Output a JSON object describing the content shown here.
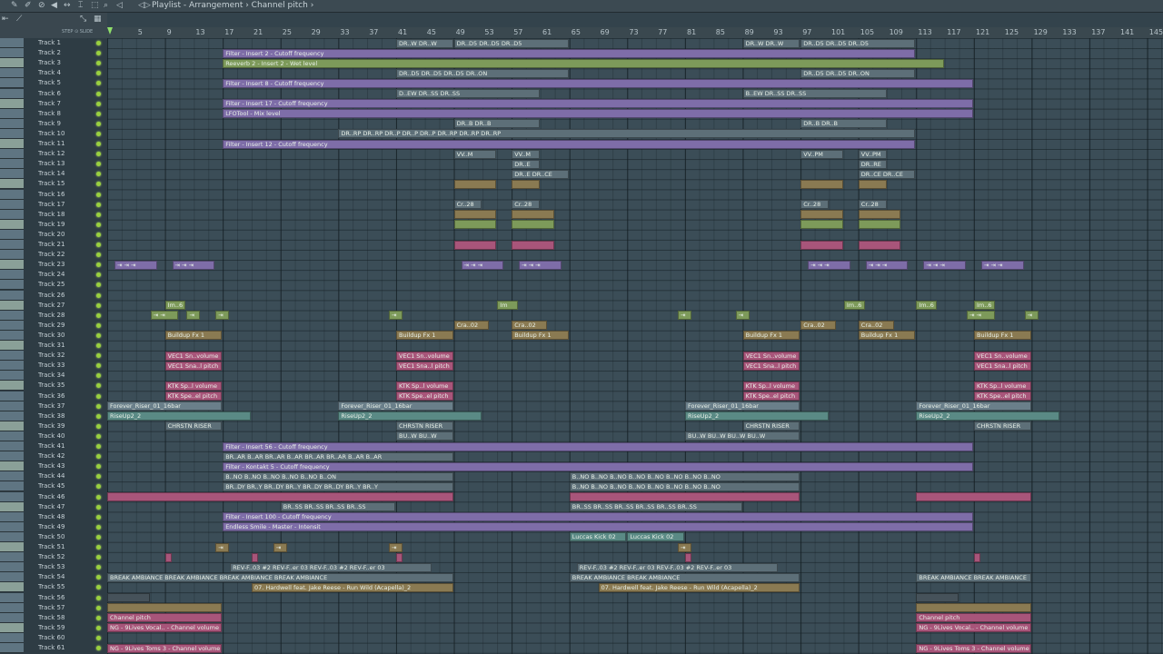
{
  "window": {
    "breadcrumb": "Playlist - Arrangement › Channel pitch ›"
  },
  "snap": {
    "label": "STEP ⊙ SLIDE"
  },
  "ruler": {
    "ticks": [
      "5",
      "9",
      "13",
      "17",
      "21",
      "25",
      "29",
      "33",
      "37",
      "41",
      "45",
      "49",
      "53",
      "57",
      "61",
      "65",
      "69",
      "73",
      "77",
      "81",
      "85",
      "89",
      "93",
      "97",
      "101",
      "105",
      "109",
      "113",
      "117",
      "121",
      "125",
      "129",
      "133",
      "137",
      "141",
      "145"
    ]
  },
  "tracks": [
    "Track 1",
    "Track 2",
    "Track 3",
    "Track 4",
    "Track 5",
    "Track 6",
    "Track 7",
    "Track 8",
    "Track 9",
    "Track 10",
    "Track 11",
    "Track 12",
    "Track 13",
    "Track 14",
    "Track 15",
    "Track 16",
    "Track 17",
    "Track 18",
    "Track 19",
    "Track 20",
    "Track 21",
    "Track 22",
    "Track 23",
    "Track 24",
    "Track 25",
    "Track 26",
    "Track 27",
    "Track 28",
    "Track 29",
    "Track 30",
    "Track 31",
    "Track 32",
    "Track 33",
    "Track 34",
    "Track 35",
    "Track 36",
    "Track 37",
    "Track 38",
    "Track 39",
    "Track 40",
    "Track 41",
    "Track 42",
    "Track 43",
    "Track 44",
    "Track 45",
    "Track 46",
    "Track 47",
    "Track 48",
    "Track 49",
    "Track 50",
    "Track 51",
    "Track 52",
    "Track 53",
    "Track 54",
    "Track 55",
    "Track 56",
    "Track 57",
    "Track 58",
    "Track 59",
    "Track 60",
    "Track 61"
  ],
  "clips": [
    {
      "t": 1,
      "s": 41,
      "e": 49,
      "c": "grey",
      "l": "DR..W  DR..W"
    },
    {
      "t": 1,
      "s": 49,
      "e": 65,
      "c": "grey",
      "l": "DR..D5  DR..D5  DR..D5"
    },
    {
      "t": 1,
      "s": 89,
      "e": 97,
      "c": "grey",
      "l": "DR..W  DR..W"
    },
    {
      "t": 1,
      "s": 97,
      "e": 113,
      "c": "grey",
      "l": "DR..D5  DR..D5  DR..D5"
    },
    {
      "t": 2,
      "s": 17,
      "e": 113,
      "c": "purple",
      "l": "Filter - Insert 2 - Cutoff frequency"
    },
    {
      "t": 3,
      "s": 17,
      "e": 117,
      "c": "green",
      "l": "Reeverb 2 - Insert 2 - Wet level"
    },
    {
      "t": 4,
      "s": 41,
      "e": 65,
      "c": "grey",
      "l": "DR..D5  DR..D5  DR..D5  DR..ON"
    },
    {
      "t": 4,
      "s": 97,
      "e": 113,
      "c": "grey",
      "l": "DR..D5  DR..D5  DR..ON"
    },
    {
      "t": 5,
      "s": 17,
      "e": 121,
      "c": "purple",
      "l": "Filter - Insert 8 - Cutoff frequency"
    },
    {
      "t": 6,
      "s": 41,
      "e": 61,
      "c": "grey",
      "l": "D..EW  DR..SS  DR..SS"
    },
    {
      "t": 6,
      "s": 89,
      "e": 109,
      "c": "grey",
      "l": "B..EW  DR..SS  DR..SS"
    },
    {
      "t": 7,
      "s": 17,
      "e": 121,
      "c": "purple",
      "l": "Filter - Insert 17 - Cutoff frequency"
    },
    {
      "t": 8,
      "s": 17,
      "e": 121,
      "c": "purple",
      "l": "LFOTool - Mix level"
    },
    {
      "t": 9,
      "s": 49,
      "e": 61,
      "c": "grey",
      "l": "DR..B  DR..B"
    },
    {
      "t": 9,
      "s": 97,
      "e": 109,
      "c": "grey",
      "l": "DR..B  DR..B"
    },
    {
      "t": 10,
      "s": 33,
      "e": 113,
      "c": "grey",
      "l": "DR..RP  DR..RP  DR..P  DR..P  DR..P  DR..RP  DR..RP  DR..RP"
    },
    {
      "t": 11,
      "s": 17,
      "e": 113,
      "c": "purple",
      "l": "Filter - Insert 12 - Cutoff frequency"
    },
    {
      "t": 12,
      "s": 49,
      "e": 55,
      "c": "grey",
      "l": "VV..M"
    },
    {
      "t": 12,
      "s": 57,
      "e": 61,
      "c": "grey",
      "l": "VV..M"
    },
    {
      "t": 12,
      "s": 97,
      "e": 103,
      "c": "grey",
      "l": "VV..PM"
    },
    {
      "t": 12,
      "s": 105,
      "e": 109,
      "c": "grey",
      "l": "VV..PM"
    },
    {
      "t": 13,
      "s": 57,
      "e": 61,
      "c": "grey",
      "l": "DR..E"
    },
    {
      "t": 13,
      "s": 105,
      "e": 109,
      "c": "grey",
      "l": "DR..RE"
    },
    {
      "t": 14,
      "s": 57,
      "e": 65,
      "c": "grey",
      "l": "DR..E  DR..CE"
    },
    {
      "t": 14,
      "s": 105,
      "e": 113,
      "c": "grey",
      "l": "DR..CE  DR..CE"
    },
    {
      "t": 15,
      "s": 49,
      "e": 55,
      "c": "gold",
      "l": ""
    },
    {
      "t": 15,
      "s": 57,
      "e": 61,
      "c": "gold",
      "l": ""
    },
    {
      "t": 15,
      "s": 97,
      "e": 103,
      "c": "gold",
      "l": ""
    },
    {
      "t": 15,
      "s": 105,
      "e": 109,
      "c": "gold",
      "l": ""
    },
    {
      "t": 17,
      "s": 49,
      "e": 53,
      "c": "grey",
      "l": "Cr..28"
    },
    {
      "t": 17,
      "s": 57,
      "e": 61,
      "c": "grey",
      "l": "Cr..28"
    },
    {
      "t": 17,
      "s": 97,
      "e": 101,
      "c": "grey",
      "l": "Cr..28"
    },
    {
      "t": 17,
      "s": 105,
      "e": 109,
      "c": "grey",
      "l": "Cr..28"
    },
    {
      "t": 18,
      "s": 49,
      "e": 55,
      "c": "gold",
      "l": ""
    },
    {
      "t": 18,
      "s": 57,
      "e": 63,
      "c": "gold",
      "l": ""
    },
    {
      "t": 18,
      "s": 97,
      "e": 103,
      "c": "gold",
      "l": ""
    },
    {
      "t": 18,
      "s": 105,
      "e": 111,
      "c": "gold",
      "l": ""
    },
    {
      "t": 19,
      "s": 49,
      "e": 55,
      "c": "green",
      "l": ""
    },
    {
      "t": 19,
      "s": 57,
      "e": 63,
      "c": "green",
      "l": ""
    },
    {
      "t": 19,
      "s": 97,
      "e": 103,
      "c": "green",
      "l": ""
    },
    {
      "t": 19,
      "s": 105,
      "e": 111,
      "c": "green",
      "l": ""
    },
    {
      "t": 21,
      "s": 49,
      "e": 55,
      "c": "pink",
      "l": ""
    },
    {
      "t": 21,
      "s": 57,
      "e": 63,
      "c": "pink",
      "l": ""
    },
    {
      "t": 21,
      "s": 97,
      "e": 103,
      "c": "pink",
      "l": ""
    },
    {
      "t": 21,
      "s": 105,
      "e": 111,
      "c": "pink",
      "l": ""
    },
    {
      "t": 23,
      "s": 2,
      "e": 8,
      "c": "purple",
      "l": "⇥ ⇥ ⇥"
    },
    {
      "t": 23,
      "s": 10,
      "e": 16,
      "c": "purple",
      "l": "⇥ ⇥ ⇥"
    },
    {
      "t": 23,
      "s": 50,
      "e": 56,
      "c": "purple",
      "l": "⇥ ⇥ ⇥"
    },
    {
      "t": 23,
      "s": 58,
      "e": 64,
      "c": "purple",
      "l": "⇥ ⇥ ⇥"
    },
    {
      "t": 23,
      "s": 98,
      "e": 104,
      "c": "purple",
      "l": "⇥ ⇥ ⇥"
    },
    {
      "t": 23,
      "s": 106,
      "e": 112,
      "c": "purple",
      "l": "⇥ ⇥ ⇥"
    },
    {
      "t": 23,
      "s": 114,
      "e": 120,
      "c": "purple",
      "l": "⇥ ⇥ ⇥"
    },
    {
      "t": 23,
      "s": 122,
      "e": 128,
      "c": "purple",
      "l": "⇥ ⇥ ⇥"
    },
    {
      "t": 27,
      "s": 9,
      "e": 12,
      "c": "green",
      "l": "Im..6"
    },
    {
      "t": 27,
      "s": 55,
      "e": 58,
      "c": "green",
      "l": "Im"
    },
    {
      "t": 27,
      "s": 103,
      "e": 106,
      "c": "green",
      "l": "Im..6"
    },
    {
      "t": 27,
      "s": 113,
      "e": 116,
      "c": "green",
      "l": "Im..6"
    },
    {
      "t": 27,
      "s": 121,
      "e": 124,
      "c": "green",
      "l": "Im..6"
    },
    {
      "t": 28,
      "s": 7,
      "e": 11,
      "c": "green",
      "l": "⇥ ⇥"
    },
    {
      "t": 28,
      "s": 12,
      "e": 14,
      "c": "green",
      "l": "⇥"
    },
    {
      "t": 28,
      "s": 16,
      "e": 18,
      "c": "green",
      "l": "⇥"
    },
    {
      "t": 28,
      "s": 40,
      "e": 42,
      "c": "green",
      "l": "⇥"
    },
    {
      "t": 28,
      "s": 80,
      "e": 82,
      "c": "green",
      "l": "⇥"
    },
    {
      "t": 28,
      "s": 88,
      "e": 90,
      "c": "green",
      "l": "⇥"
    },
    {
      "t": 28,
      "s": 120,
      "e": 124,
      "c": "green",
      "l": "⇥ ⇥"
    },
    {
      "t": 28,
      "s": 128,
      "e": 130,
      "c": "green",
      "l": "⇥"
    },
    {
      "t": 29,
      "s": 49,
      "e": 54,
      "c": "gold",
      "l": "Cra..02"
    },
    {
      "t": 29,
      "s": 57,
      "e": 62,
      "c": "gold",
      "l": "Cra..02"
    },
    {
      "t": 29,
      "s": 97,
      "e": 102,
      "c": "gold",
      "l": "Cra..02"
    },
    {
      "t": 29,
      "s": 105,
      "e": 110,
      "c": "gold",
      "l": "Cra..02"
    },
    {
      "t": 30,
      "s": 9,
      "e": 17,
      "c": "gold",
      "l": "Buildup Fx 1"
    },
    {
      "t": 30,
      "s": 41,
      "e": 49,
      "c": "gold",
      "l": "Buildup Fx 1"
    },
    {
      "t": 30,
      "s": 57,
      "e": 65,
      "c": "gold",
      "l": "Buildup Fx 1"
    },
    {
      "t": 30,
      "s": 89,
      "e": 97,
      "c": "gold",
      "l": "Buildup Fx 1"
    },
    {
      "t": 30,
      "s": 105,
      "e": 113,
      "c": "gold",
      "l": "Buildup Fx 1"
    },
    {
      "t": 30,
      "s": 121,
      "e": 129,
      "c": "gold",
      "l": "Buildup Fx 1"
    },
    {
      "t": 32,
      "s": 9,
      "e": 17,
      "c": "pink",
      "l": "VEC1 Sn..volume"
    },
    {
      "t": 32,
      "s": 41,
      "e": 49,
      "c": "pink",
      "l": "VEC1 Sn..volume"
    },
    {
      "t": 32,
      "s": 89,
      "e": 97,
      "c": "pink",
      "l": "VEC1 Sn..volume"
    },
    {
      "t": 32,
      "s": 121,
      "e": 129,
      "c": "pink",
      "l": "VEC1 Sn..volume"
    },
    {
      "t": 33,
      "s": 9,
      "e": 17,
      "c": "pink",
      "l": "VEC1 Sna..l pitch"
    },
    {
      "t": 33,
      "s": 41,
      "e": 49,
      "c": "pink",
      "l": "VEC1 Sna..l pitch"
    },
    {
      "t": 33,
      "s": 89,
      "e": 97,
      "c": "pink",
      "l": "VEC1 Sna..l pitch"
    },
    {
      "t": 33,
      "s": 121,
      "e": 129,
      "c": "pink",
      "l": "VEC1 Sna..l pitch"
    },
    {
      "t": 35,
      "s": 9,
      "e": 17,
      "c": "pink",
      "l": "KTK Sp..l volume"
    },
    {
      "t": 35,
      "s": 41,
      "e": 49,
      "c": "pink",
      "l": "KTK Sp..l volume"
    },
    {
      "t": 35,
      "s": 89,
      "e": 97,
      "c": "pink",
      "l": "KTK Sp..l volume"
    },
    {
      "t": 35,
      "s": 121,
      "e": 129,
      "c": "pink",
      "l": "KTK Sp..l volume"
    },
    {
      "t": 36,
      "s": 9,
      "e": 17,
      "c": "pink",
      "l": "KTK Spe..el pitch"
    },
    {
      "t": 36,
      "s": 41,
      "e": 49,
      "c": "pink",
      "l": "KTK Spe..el pitch"
    },
    {
      "t": 36,
      "s": 89,
      "e": 97,
      "c": "pink",
      "l": "KTK Spe..el pitch"
    },
    {
      "t": 36,
      "s": 121,
      "e": 129,
      "c": "pink",
      "l": "KTK Spe..el pitch"
    },
    {
      "t": 37,
      "s": 1,
      "e": 17,
      "c": "steel",
      "l": "Forever_Riser_01_16bar"
    },
    {
      "t": 37,
      "s": 33,
      "e": 49,
      "c": "steel",
      "l": "Forever_Riser_01_16bar"
    },
    {
      "t": 37,
      "s": 81,
      "e": 97,
      "c": "steel",
      "l": "Forever_Riser_01_16bar"
    },
    {
      "t": 37,
      "s": 113,
      "e": 129,
      "c": "steel",
      "l": "Forever_Riser_01_16bar"
    },
    {
      "t": 38,
      "s": 1,
      "e": 21,
      "c": "teal",
      "l": "RiseUp2_2"
    },
    {
      "t": 38,
      "s": 33,
      "e": 53,
      "c": "teal",
      "l": "RiseUp2_2"
    },
    {
      "t": 38,
      "s": 81,
      "e": 101,
      "c": "teal",
      "l": "RiseUp2_2"
    },
    {
      "t": 38,
      "s": 113,
      "e": 133,
      "c": "teal",
      "l": "RiseUp2_2"
    },
    {
      "t": 39,
      "s": 9,
      "e": 17,
      "c": "grey",
      "l": "CHRSTN RISER"
    },
    {
      "t": 39,
      "s": 41,
      "e": 49,
      "c": "grey",
      "l": "CHRSTN RISER"
    },
    {
      "t": 39,
      "s": 89,
      "e": 97,
      "c": "grey",
      "l": "CHRSTN RISER"
    },
    {
      "t": 39,
      "s": 121,
      "e": 129,
      "c": "grey",
      "l": "CHRSTN RISER"
    },
    {
      "t": 40,
      "s": 41,
      "e": 49,
      "c": "grey",
      "l": "BU..W  BU..W"
    },
    {
      "t": 40,
      "s": 81,
      "e": 97,
      "c": "grey",
      "l": "BU..W  BU..W  BU..W  BU..W"
    },
    {
      "t": 41,
      "s": 17,
      "e": 121,
      "c": "purple",
      "l": "Filter - Insert 56 - Cutoff frequency"
    },
    {
      "t": 42,
      "s": 17,
      "e": 49,
      "c": "grey",
      "l": "BR..AR  B..AR  BR..AR  B..AR  BR..AR  BR..AR  B..AR  B..AR"
    },
    {
      "t": 43,
      "s": 17,
      "e": 121,
      "c": "purple",
      "l": "Filter - Kontakt 5 - Cutoff frequency"
    },
    {
      "t": 44,
      "s": 17,
      "e": 49,
      "c": "grey",
      "l": "B..NO  B..NO  B..NO  B..NO  B..NO  B..ON"
    },
    {
      "t": 44,
      "s": 65,
      "e": 97,
      "c": "grey",
      "l": "B..NO  B..NO  B..NO  B..NO  B..NO  B..NO  B..NO  B..NO"
    },
    {
      "t": 45,
      "s": 17,
      "e": 49,
      "c": "grey",
      "l": "BR..DY  BR..Y  BR..DY  BR..Y  BR..DY  BR..DY  BR..Y  BR..Y"
    },
    {
      "t": 45,
      "s": 65,
      "e": 97,
      "c": "grey",
      "l": "B..NO  B..NO  B..NO  B..NO  B..NO  B..NO  B..NO  B..NO"
    },
    {
      "t": 46,
      "s": 1,
      "e": 49,
      "c": "pink",
      "l": ""
    },
    {
      "t": 46,
      "s": 65,
      "e": 97,
      "c": "pink",
      "l": ""
    },
    {
      "t": 46,
      "s": 113,
      "e": 129,
      "c": "pink",
      "l": ""
    },
    {
      "t": 47,
      "s": 25,
      "e": 41,
      "c": "grey",
      "l": "BR..SS  BR..SS  BR..SS  BR..SS"
    },
    {
      "t": 47,
      "s": 65,
      "e": 89,
      "c": "grey",
      "l": "BR..SS  BR..SS  BR..SS  BR..SS  BR..SS  BR..SS"
    },
    {
      "t": 48,
      "s": 17,
      "e": 121,
      "c": "purple",
      "l": "Filter - Insert 100 - Cutoff frequency"
    },
    {
      "t": 49,
      "s": 17,
      "e": 121,
      "c": "purple",
      "l": "Endless Smile - Master - Intensit"
    },
    {
      "t": 50,
      "s": 65,
      "e": 73,
      "c": "teal",
      "l": "Luccas Kick 02"
    },
    {
      "t": 50,
      "s": 73,
      "e": 81,
      "c": "teal",
      "l": "Luccas Kick 02"
    },
    {
      "t": 51,
      "s": 16,
      "e": 18,
      "c": "gold",
      "l": "⇥"
    },
    {
      "t": 51,
      "s": 24,
      "e": 26,
      "c": "gold",
      "l": "⇥"
    },
    {
      "t": 51,
      "s": 40,
      "e": 42,
      "c": "gold",
      "l": "⇥"
    },
    {
      "t": 51,
      "s": 80,
      "e": 82,
      "c": "gold",
      "l": "⇥"
    },
    {
      "t": 52,
      "s": 9,
      "e": 10,
      "c": "pink",
      "l": ""
    },
    {
      "t": 52,
      "s": 21,
      "e": 22,
      "c": "pink",
      "l": ""
    },
    {
      "t": 52,
      "s": 41,
      "e": 42,
      "c": "pink",
      "l": ""
    },
    {
      "t": 52,
      "s": 81,
      "e": 82,
      "c": "pink",
      "l": ""
    },
    {
      "t": 52,
      "s": 121,
      "e": 122,
      "c": "pink",
      "l": ""
    },
    {
      "t": 53,
      "s": 18,
      "e": 46,
      "c": "grey",
      "l": "REV-F..03 #2  REV-F..er 03  REV-F..03 #2  REV-F..er 03"
    },
    {
      "t": 53,
      "s": 66,
      "e": 94,
      "c": "grey",
      "l": "REV-F..03 #2  REV-F..er 03  REV-F..03 #2  REV-F..er 03"
    },
    {
      "t": 54,
      "s": 1,
      "e": 49,
      "c": "grey",
      "l": "BREAK AMBIANCE  BREAK AMBIANCE  BREAK AMBIANCE  BREAK AMBIANCE"
    },
    {
      "t": 54,
      "s": 65,
      "e": 97,
      "c": "grey",
      "l": "BREAK AMBIANCE  BREAK AMBIANCE"
    },
    {
      "t": 54,
      "s": 113,
      "e": 129,
      "c": "grey",
      "l": "BREAK AMBIANCE  BREAK AMBIANCE"
    },
    {
      "t": 55,
      "s": 21,
      "e": 49,
      "c": "gold",
      "l": "07. Hardwell feat. Jake Reese - Run Wild (Acapella)_2"
    },
    {
      "t": 55,
      "s": 69,
      "e": 97,
      "c": "gold",
      "l": "07. Hardwell feat. Jake Reese - Run Wild (Acapella)_2"
    },
    {
      "t": 56,
      "s": 1,
      "e": 7,
      "c": "dark",
      "l": ""
    },
    {
      "t": 56,
      "s": 113,
      "e": 119,
      "c": "dark",
      "l": ""
    },
    {
      "t": 57,
      "s": 1,
      "e": 17,
      "c": "gold",
      "l": ""
    },
    {
      "t": 57,
      "s": 113,
      "e": 129,
      "c": "gold",
      "l": ""
    },
    {
      "t": 58,
      "s": 1,
      "e": 17,
      "c": "pink",
      "l": "Channel pitch"
    },
    {
      "t": 58,
      "s": 113,
      "e": 129,
      "c": "pink",
      "l": "Channel pitch"
    },
    {
      "t": 59,
      "s": 1,
      "e": 17,
      "c": "pink",
      "l": "NG - 9Lives Vocal.. - Channel volume"
    },
    {
      "t": 59,
      "s": 113,
      "e": 129,
      "c": "pink",
      "l": "NG - 9Lives Vocal.. - Channel volume"
    },
    {
      "t": 61,
      "s": 1,
      "e": 17,
      "c": "pink",
      "l": "NG - 9Lives Toms 3 - Channel volume"
    },
    {
      "t": 61,
      "s": 113,
      "e": 129,
      "c": "pink",
      "l": "NG - 9Lives Toms 3 - Channel volume"
    }
  ]
}
